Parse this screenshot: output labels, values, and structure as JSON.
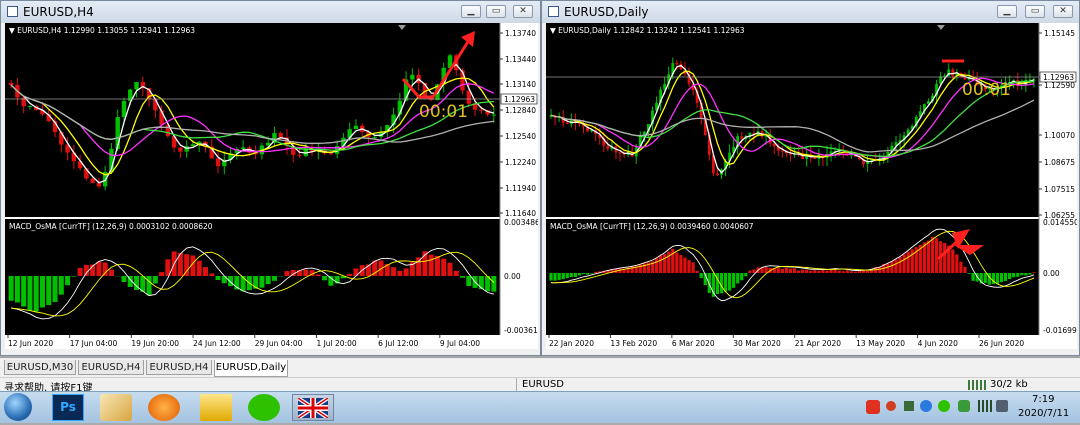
{
  "left_window": {
    "title": "EURUSD,H4",
    "chart_header": "EURUSD,H4  1.12990 1.13055 1.12941 1.12963",
    "overlay_time": "00:01",
    "price_ticks": [
      "1.13740",
      "1.13440",
      "1.13140",
      "1.12840",
      "1.12540",
      "1.12240",
      "1.11940",
      "1.11640"
    ],
    "current_price": "1.12963",
    "indicator_header": "MACD_OsMA [CurrTF] (12,26,9) 0.0003102 0.0008620",
    "indicator_ticks": [
      "0.0034869",
      "0.00",
      "-0.003613"
    ],
    "time_ticks": [
      "12 Jun 2020",
      "17 Jun 04:00",
      "19 Jun 20:00",
      "24 Jun 12:00",
      "29 Jun 04:00",
      "1 Jul 20:00",
      "6 Jul 12:00",
      "9 Jul 04:00"
    ]
  },
  "right_window": {
    "title": "EURUSD,Daily",
    "chart_header": "EURUSD,Daily  1.12842 1.13242 1.12541 1.12963",
    "overlay_time": "00:01",
    "price_ticks": [
      "1.15145",
      "1.12963",
      "1.12590",
      "1.10070",
      "1.08675",
      "1.07515",
      "1.06255"
    ],
    "current_price": "1.12963",
    "indicator_header": "MACD_OsMA [CurrTF] (12,26,9) 0.0039460 0.0040607",
    "indicator_ticks": [
      "0.0145509",
      "0.00",
      "-0.016995"
    ],
    "time_ticks": [
      "22 Jan 2020",
      "13 Feb 2020",
      "6 Mar 2020",
      "30 Mar 2020",
      "21 Apr 2020",
      "13 May 2020",
      "4 Jun 2020",
      "26 Jun 2020"
    ]
  },
  "tabs": [
    "EURUSD,M30",
    "EURUSD,H4",
    "EURUSD,H4",
    "EURUSD,Daily"
  ],
  "status": {
    "help": "寻求帮助, 请按F1键",
    "symbol": "EURUSD",
    "traffic": "30/2 kb"
  },
  "taskbar": {
    "time": "7:19",
    "date": "2020/7/11",
    "ps_label": "Ps"
  },
  "colors": {
    "bull": "#00c000",
    "bear": "#e01010",
    "osma_pos": "#e01010",
    "osma_neg": "#00c000",
    "ma_white": "#ffffff",
    "ma_yellow": "#ffff00",
    "ma_magenta": "#ff30ff",
    "ma_green": "#40e040",
    "ma_gray": "#b0b0b0",
    "arrow": "#ff2020",
    "overlay_text": "#e0c020"
  }
}
